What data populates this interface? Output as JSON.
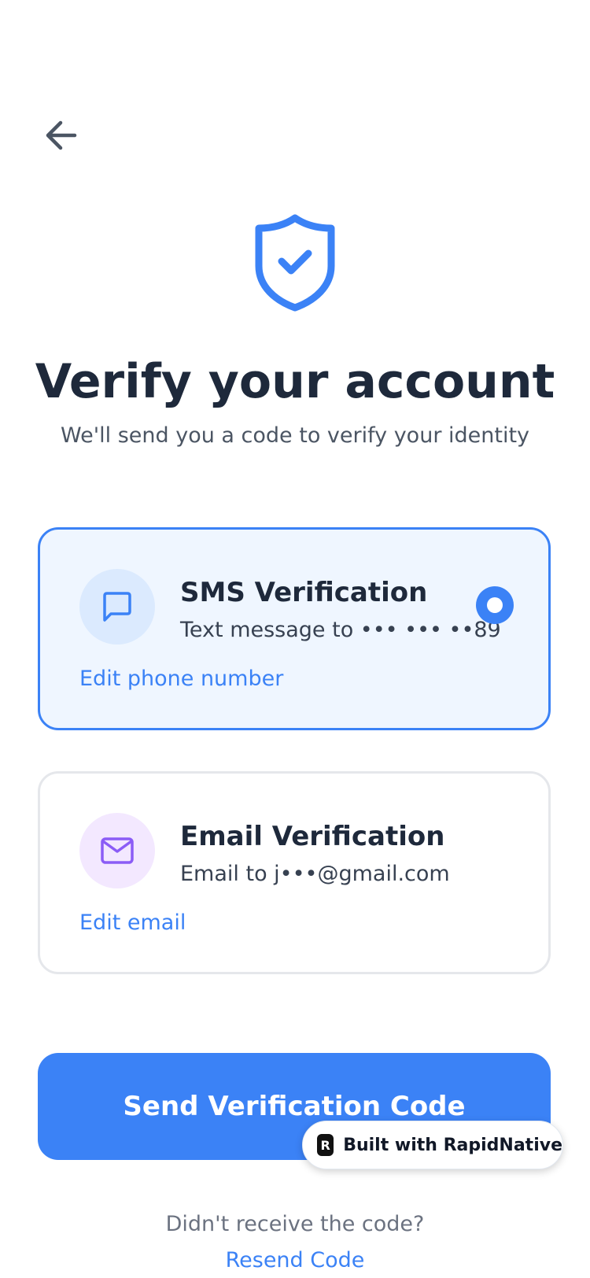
{
  "header": {
    "back_icon": "arrow-left-icon"
  },
  "hero": {
    "icon": "shield-check-icon",
    "title": "Verify your account",
    "subtitle": "We'll send you a code to verify your identity"
  },
  "options": [
    {
      "id": "sms",
      "icon": "message-square-icon",
      "title": "SMS Verification",
      "subtitle": "Text message to ••• ••• ••89",
      "edit_label": "Edit phone number",
      "selected": true
    },
    {
      "id": "email",
      "icon": "mail-icon",
      "title": "Email Verification",
      "subtitle": "Email to j•••@gmail.com",
      "edit_label": "Edit email",
      "selected": false
    }
  ],
  "actions": {
    "send_label": "Send Verification Code"
  },
  "footer": {
    "prompt": "Didn't receive the code?",
    "resend_label": "Resend Code"
  },
  "badge": {
    "logo_letter": "R",
    "label": "Built with RapidNative"
  },
  "colors": {
    "primary": "#3b82f6",
    "sms_bg": "#eff6ff",
    "sms_icon_bg": "#dbeafe",
    "email_icon": "#8b5cf6",
    "email_icon_bg": "#f3e8ff",
    "text_dark": "#1e293b"
  }
}
